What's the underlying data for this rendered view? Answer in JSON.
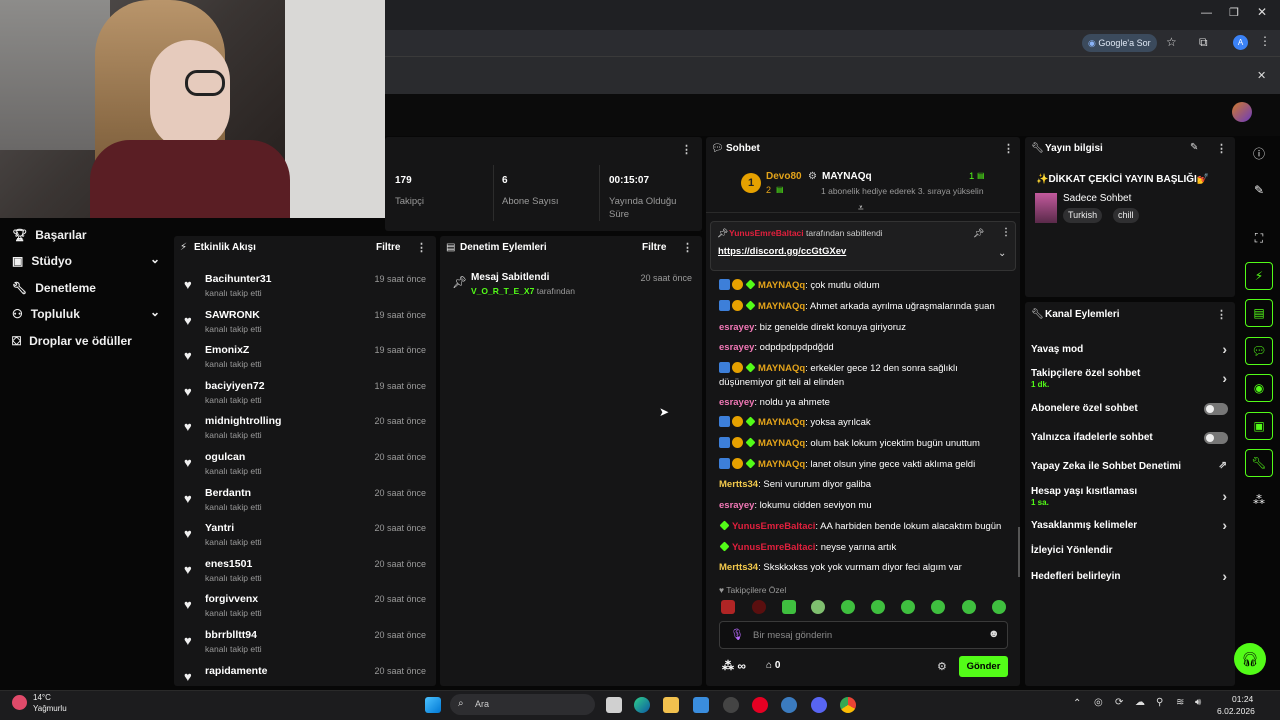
{
  "browser": {
    "google_btn": "Google'a Sor",
    "avatar_letter": "A"
  },
  "sidebar": {
    "items": [
      {
        "label": "Başarılar"
      },
      {
        "label": "Stüdyo"
      },
      {
        "label": "Denetleme"
      },
      {
        "label": "Topluluk"
      },
      {
        "label": "Droplar ve ödüller"
      }
    ]
  },
  "stats": {
    "followers_value": "179",
    "followers_label": "Takipçi",
    "subs_value": "6",
    "subs_label": "Abone Sayısı",
    "uptime_value": "00:15:07",
    "uptime_label": "Yayında Olduğu Süre"
  },
  "activity_feed": {
    "title": "Etkinlik Akışı",
    "filter": "Filtre",
    "items": [
      {
        "name": "Bacihunter31",
        "action": "kanalı takip etti",
        "time": "19 saat önce"
      },
      {
        "name": "SAWRONK",
        "action": "kanalı takip etti",
        "time": "19 saat önce"
      },
      {
        "name": "EmonixZ",
        "action": "kanalı takip etti",
        "time": "19 saat önce"
      },
      {
        "name": "baciyiyen72",
        "action": "kanalı takip etti",
        "time": "19 saat önce"
      },
      {
        "name": "midnightrolling",
        "action": "kanalı takip etti",
        "time": "20 saat önce"
      },
      {
        "name": "ogulcan",
        "action": "kanalı takip etti",
        "time": "20 saat önce"
      },
      {
        "name": "Berdantn",
        "action": "kanalı takip etti",
        "time": "20 saat önce"
      },
      {
        "name": "Yantri",
        "action": "kanalı takip etti",
        "time": "20 saat önce"
      },
      {
        "name": "enes1501",
        "action": "kanalı takip etti",
        "time": "20 saat önce"
      },
      {
        "name": "forgivvenx",
        "action": "kanalı takip etti",
        "time": "20 saat önce"
      },
      {
        "name": "bbrrblltt94",
        "action": "kanalı takip etti",
        "time": "20 saat önce"
      },
      {
        "name": "rapidamente",
        "action": "",
        "time": "20 saat önce"
      }
    ]
  },
  "mod_actions": {
    "title": "Denetim Eylemleri",
    "filter": "Filtre",
    "item_title": "Mesaj Sabitlendi",
    "item_user": "V_O_R_T_E_X7",
    "item_suffix": "tarafından",
    "item_time": "20 saat önce"
  },
  "chat": {
    "title": "Sohbet",
    "leader1_name": "Devo80",
    "leader1_count": "2",
    "leader2_name": "MAYNAQq",
    "leader2_count": "1",
    "leader_note": "1 abonelik hediye ederek 3. sıraya yükselin",
    "pinned_user": "YunusEmreBaltaci",
    "pinned_suffix": "tarafından sabitlendi",
    "pinned_link": "https://discord.gg/ccGtGXev",
    "messages": [
      {
        "user": "MAYNAQq",
        "text": ": çok mutlu oldum"
      },
      {
        "user": "MAYNAQq",
        "text": ": Ahmet arkada ayrılma uğraşmalarında şuan"
      },
      {
        "user": "esrayey",
        "text": ": biz genelde direkt konuya giriyoruz"
      },
      {
        "user": "esrayey",
        "text": ": odpdpdppdpdğdd"
      },
      {
        "user": "MAYNAQq",
        "text": ": erkekler gece 12 den sonra sağlıklı düşünemiyor git teli al elinden"
      },
      {
        "user": "esrayey",
        "text": ": noldu ya ahmete"
      },
      {
        "user": "MAYNAQq",
        "text": ": yoksa ayrılcak"
      },
      {
        "user": "MAYNAQq",
        "text": ": olum bak lokum yicektim bugün unuttum"
      },
      {
        "user": "MAYNAQq",
        "text": ": lanet olsun yine gece vakti aklıma geldi"
      },
      {
        "user": "Mertts34",
        "text": ": Seni vururum diyor galiba"
      },
      {
        "user": "esrayey",
        "text": ": lokumu cidden seviyon mu"
      },
      {
        "user": "YunusEmreBaltaci",
        "text": ": AA harbiden bende lokum alacaktım bugün"
      },
      {
        "user": "YunusEmreBaltaci",
        "text": ": neyse yarına artık"
      },
      {
        "user": "Mertts34",
        "text": ": Skskkxkss yok yok vurmam diyor feci algım var"
      }
    ],
    "followers_only": "Takipçilere Özel",
    "input_placeholder": "Bir mesaj gönderin",
    "points": "∞",
    "store_count": "0",
    "send_label": "Gönder"
  },
  "stream_info": {
    "title": "Yayın bilgisi",
    "stream_title": "✨DİKKAT ÇEKİCİ YAYIN BAŞLIĞI💅",
    "category": "Sadece Sohbet",
    "tags": [
      "Turkish",
      "chill"
    ]
  },
  "channel_actions": {
    "title": "Kanal Eylemleri",
    "items": [
      {
        "label": "Yavaş mod",
        "sub": ""
      },
      {
        "label": "Takipçilere özel sohbet",
        "sub": "1 dk."
      },
      {
        "label": "Abonelere özel sohbet",
        "sub": ""
      },
      {
        "label": "Yalnızca ifadelerle sohbet",
        "sub": ""
      },
      {
        "label": "Yapay Zeka ile Sohbet Denetimi",
        "sub": ""
      },
      {
        "label": "Hesap yaşı kısıtlaması",
        "sub": "1 sa."
      },
      {
        "label": "Yasaklanmış kelimeler",
        "sub": ""
      },
      {
        "label": "İzleyici Yönlendir",
        "sub": ""
      },
      {
        "label": "Hedefleri belirleyin",
        "sub": ""
      }
    ]
  },
  "taskbar": {
    "weather_temp": "14°C",
    "weather_desc": "Yağmurlu",
    "search": "Ara",
    "time": "01:24",
    "date": "6.02.2026"
  },
  "colors": {
    "accent": "#53fc18",
    "panel": "#151516"
  }
}
